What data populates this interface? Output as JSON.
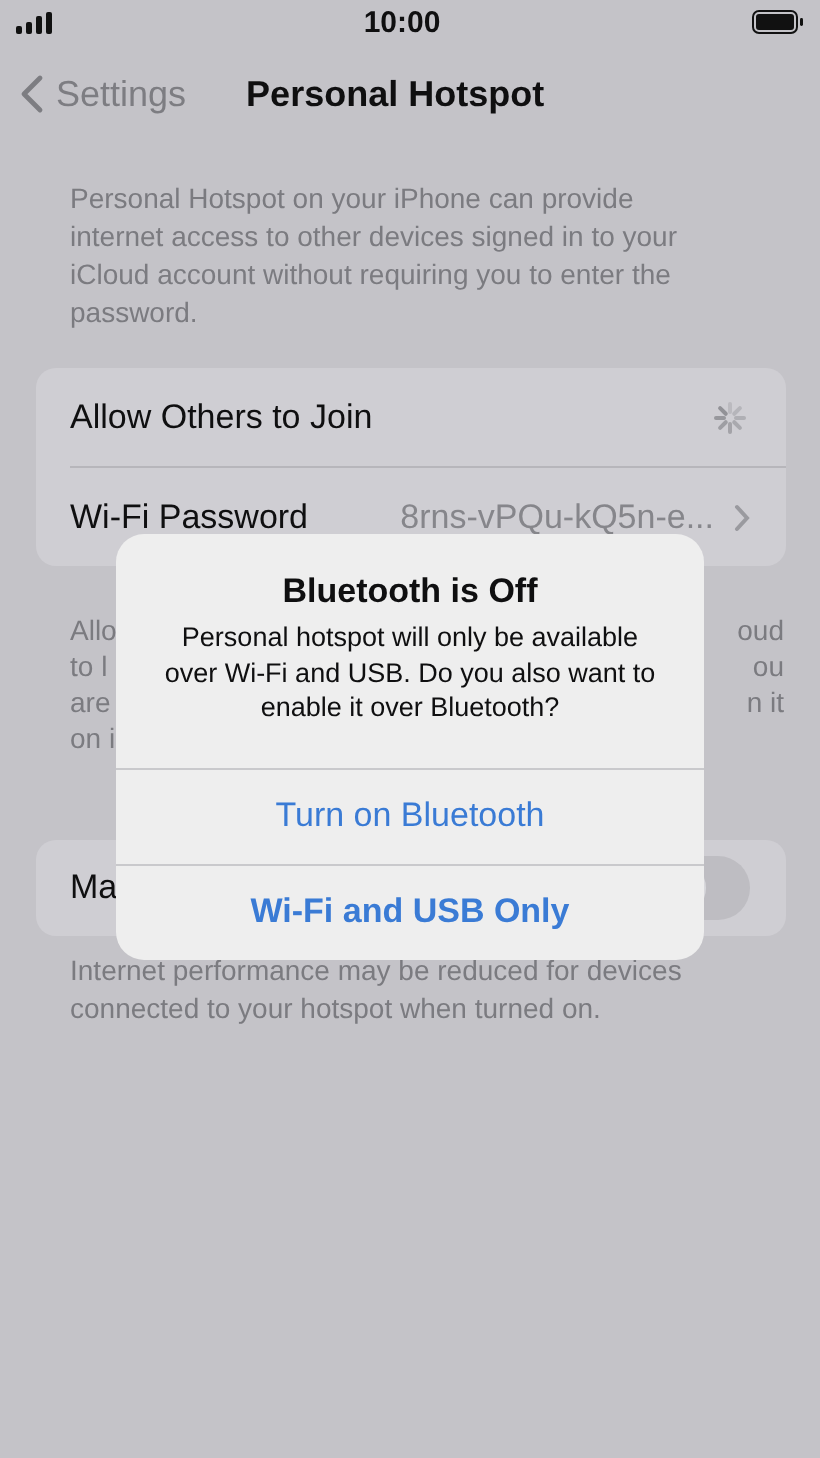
{
  "status_bar": {
    "time": "10:00"
  },
  "nav": {
    "back": "Settings",
    "title": "Personal Hotspot"
  },
  "intro": "Personal Hotspot on your iPhone can provide internet access to other devices signed in to your iCloud account without requiring you to enter the password.",
  "settings": [
    {
      "kind": "spinner",
      "label": "Allow Others to Join"
    },
    {
      "kind": "value",
      "label": "Wi-Fi Password",
      "value": "8rns-vPQu-kQ5n-e..."
    }
  ],
  "footer_fragments": [
    {
      "left": "Allo",
      "right": "oud"
    },
    {
      "left": "to l",
      "right": "ou"
    },
    {
      "left": "are",
      "right": "n it"
    },
    {
      "left": "on i"
    }
  ],
  "maximize": {
    "label": "Ma",
    "on": false
  },
  "maximize_footer": "Internet performance may be reduced for devices connected to your hotspot when turned on.",
  "alert": {
    "title": "Bluetooth is Off",
    "message": "Personal hotspot will only be available over Wi-Fi and USB. Do you also want to enable it over Bluetooth?",
    "buttons": [
      {
        "label": "Turn on Bluetooth",
        "bold": false
      },
      {
        "label": "Wi-Fi and USB Only",
        "bold": true
      }
    ]
  }
}
